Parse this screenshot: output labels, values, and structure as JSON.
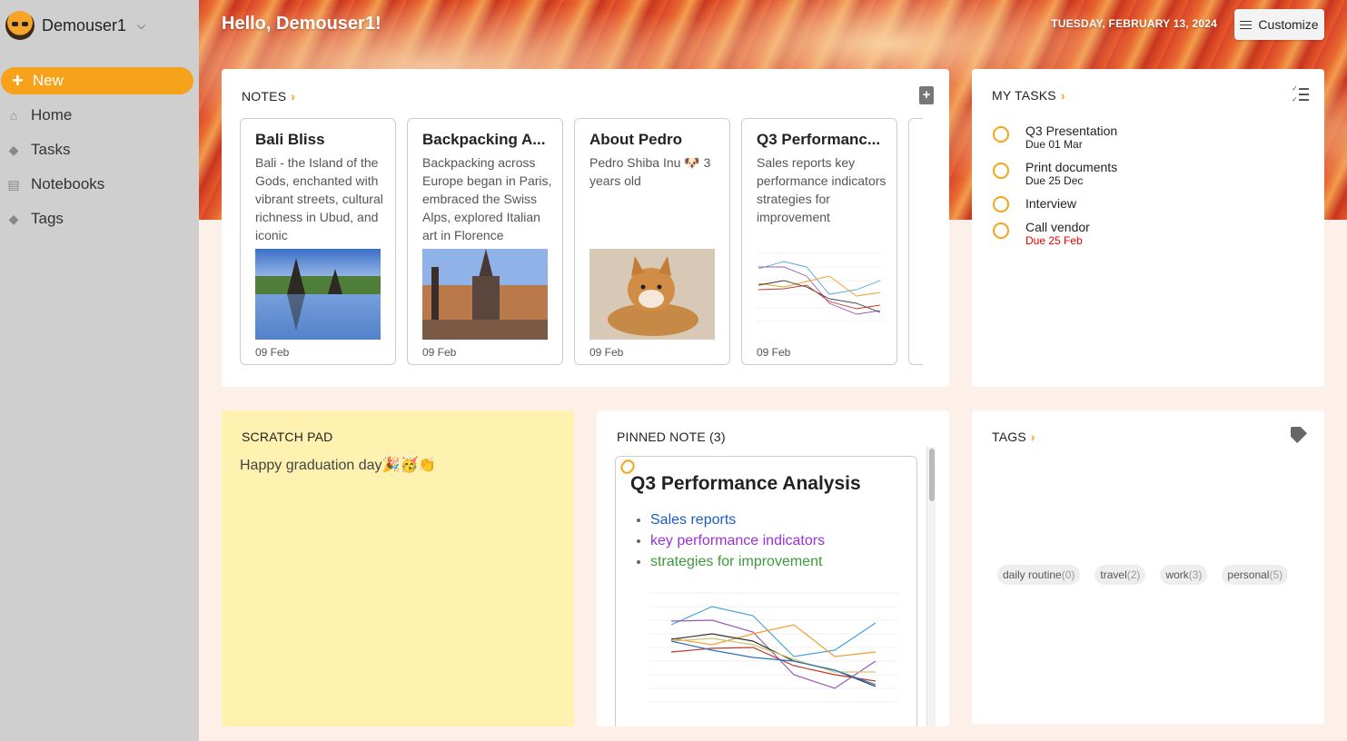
{
  "sidebar": {
    "account_name": "Demouser1",
    "new_label": "New",
    "items": [
      {
        "label": "Home",
        "icon": "home-icon"
      },
      {
        "label": "Tasks",
        "icon": "tag-icon"
      },
      {
        "label": "Notebooks",
        "icon": "book-icon"
      },
      {
        "label": "Tags",
        "icon": "tag-icon"
      }
    ]
  },
  "header": {
    "greeting": "Hello, Demouser1!",
    "date": "TUESDAY, FEBRUARY 13, 2024",
    "customize_label": "Customize"
  },
  "notes": {
    "title": "NOTES",
    "items": [
      {
        "title": "Bali Bliss",
        "body": "Bali - the Island of the Gods, enchanted with vibrant streets, cultural richness in Ubud, and iconic",
        "date": "09 Feb"
      },
      {
        "title": "Backpacking A...",
        "body": "Backpacking across Europe began in Paris, embraced the Swiss Alps, explored Italian art in Florence",
        "date": "09 Feb"
      },
      {
        "title": "About Pedro",
        "body": "Pedro Shiba Inu 🐶 3 years old",
        "date": "09 Feb"
      },
      {
        "title": "Q3 Performanc...",
        "body": "Sales reports key performance indicators strategies for improvement",
        "date": "09 Feb"
      }
    ]
  },
  "tasks": {
    "title": "MY TASKS",
    "items": [
      {
        "name": "Q3 Presentation",
        "due": "Due 01 Mar",
        "overdue": false
      },
      {
        "name": "Print documents",
        "due": "Due 25 Dec",
        "overdue": false
      },
      {
        "name": "Interview",
        "due": "",
        "overdue": false
      },
      {
        "name": "Call vendor",
        "due": "Due 25 Feb",
        "overdue": true
      }
    ]
  },
  "scratch": {
    "title": "SCRATCH PAD",
    "text": "Happy graduation day🎉🥳👏"
  },
  "pinned": {
    "title": "PINNED NOTE (3)",
    "note_title": "Q3 Performance Analysis",
    "bullets": [
      {
        "text": "Sales reports",
        "color": "#1a5dc8"
      },
      {
        "text": "key performance indicators",
        "color": "#9b30d9"
      },
      {
        "text": "strategies for improvement",
        "color": "#3b9a3b"
      }
    ]
  },
  "tags": {
    "title": "TAGS",
    "items": [
      {
        "name": "daily routine",
        "count": "(0)"
      },
      {
        "name": "travel",
        "count": "(2)"
      },
      {
        "name": "work",
        "count": "(3)"
      },
      {
        "name": "personal",
        "count": "(5)"
      }
    ]
  },
  "colors": {
    "accent": "#f7a21b",
    "overdue": "#e00000",
    "scratch_bg": "#fff1b0"
  }
}
